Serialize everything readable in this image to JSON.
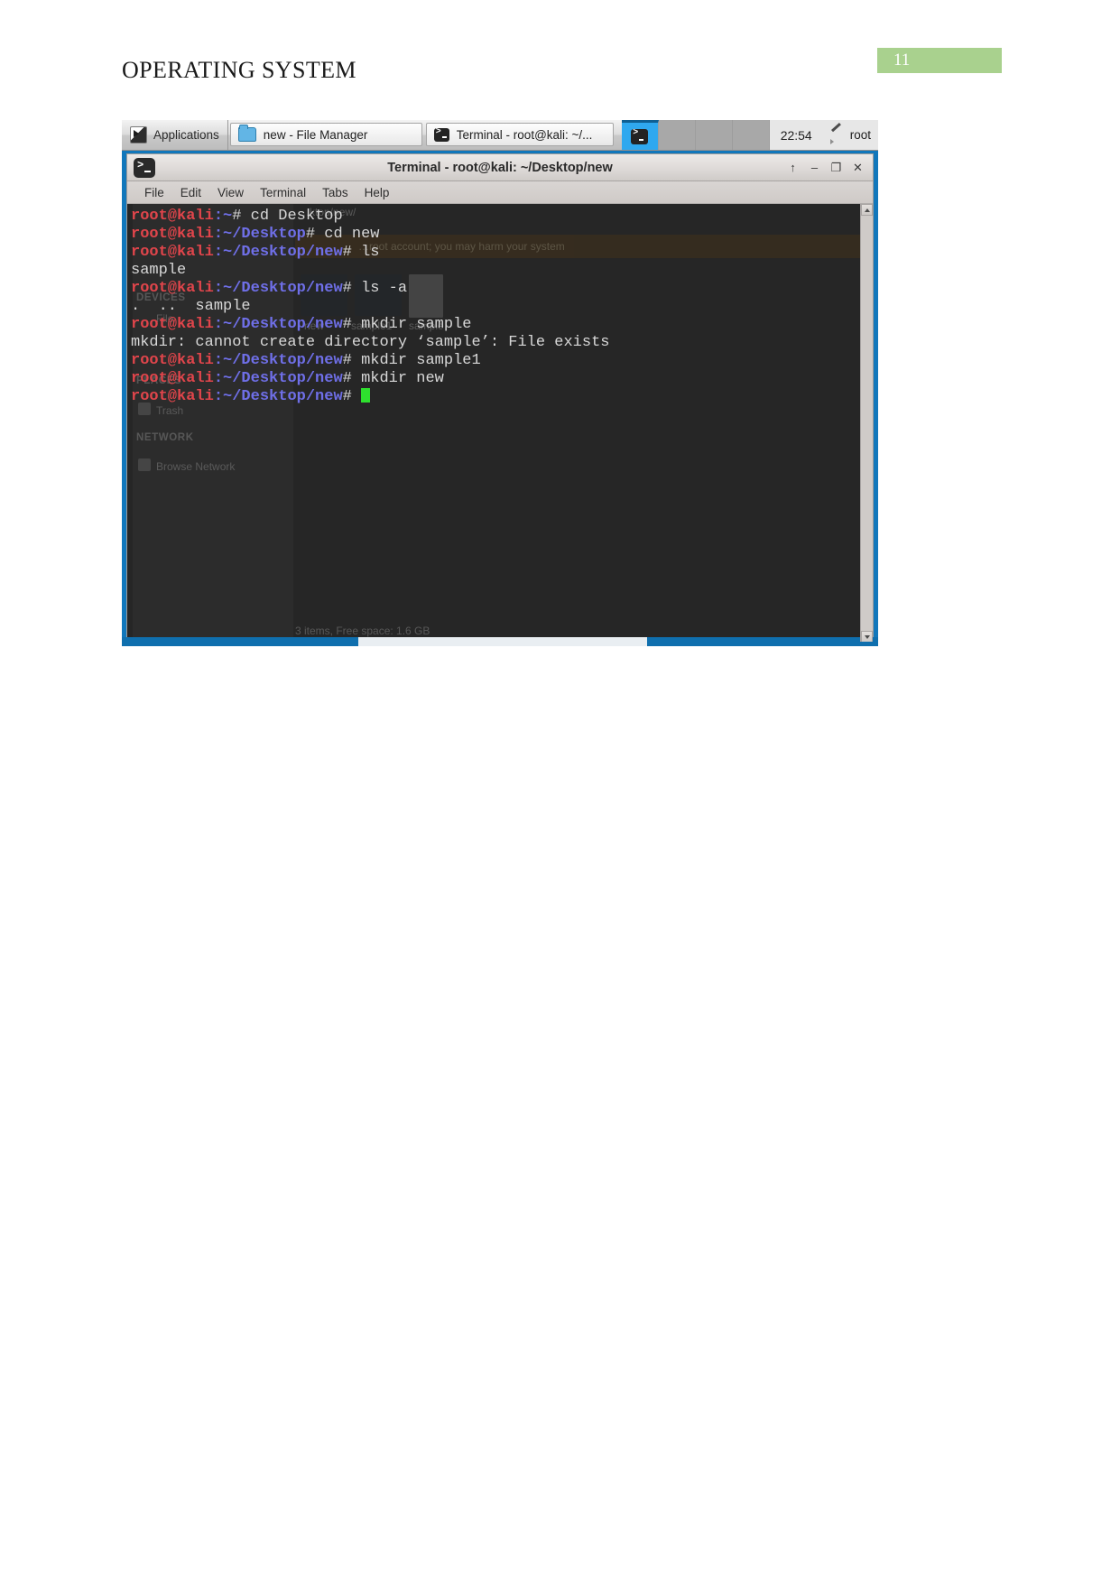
{
  "document": {
    "title": "OPERATING SYSTEM",
    "page_number": "11",
    "badge_color": "#a9d18e"
  },
  "panel": {
    "applications_label": "Applications",
    "applications_icon": "applications-menu-icon",
    "tasks": [
      {
        "label": "new - File Manager",
        "icon": "folder-icon"
      },
      {
        "label": "Terminal - root@kali: ~/...",
        "icon": "terminal-icon"
      }
    ],
    "workspaces": [
      {
        "active": true,
        "icon": "terminal-icon"
      },
      {
        "active": false
      },
      {
        "active": false
      },
      {
        "active": false
      }
    ],
    "clock": "22:54",
    "tray": {
      "pen_icon": "pen-icon",
      "user": "root"
    }
  },
  "terminal_window": {
    "title": "Terminal - root@kali: ~/Desktop/new",
    "icon": "terminal-icon",
    "window_buttons": [
      {
        "name": "shade-button",
        "glyph": "↑"
      },
      {
        "name": "minimize-button",
        "glyph": "–"
      },
      {
        "name": "maximize-button",
        "glyph": "❐"
      },
      {
        "name": "close-button",
        "glyph": "✕"
      }
    ],
    "menus": [
      "File",
      "Edit",
      "View",
      "Terminal",
      "Tabs",
      "Help"
    ],
    "lines": [
      {
        "user": "root@kali",
        "path": ":~",
        "prompt": "# ",
        "cmd": "cd Desktop"
      },
      {
        "user": "root@kali",
        "path": ":~/Desktop",
        "prompt": "# ",
        "cmd": "cd new"
      },
      {
        "user": "root@kali",
        "path": ":~/Desktop/new",
        "prompt": "# ",
        "cmd": "ls"
      },
      {
        "output": "sample"
      },
      {
        "user": "root@kali",
        "path": ":~/Desktop/new",
        "prompt": "# ",
        "cmd": "ls -a"
      },
      {
        "output": ".  ..  sample"
      },
      {
        "user": "root@kali",
        "path": ":~/Desktop/new",
        "prompt": "# ",
        "cmd": "mkdir sample"
      },
      {
        "output": "mkdir: cannot create directory ‘sample’: File exists"
      },
      {
        "user": "root@kali",
        "path": ":~/Desktop/new",
        "prompt": "# ",
        "cmd": "mkdir sample1"
      },
      {
        "user": "root@kali",
        "path": ":~/Desktop/new",
        "prompt": "# ",
        "cmd": "mkdir new"
      },
      {
        "user": "root@kali",
        "path": ":~/Desktop/new",
        "prompt": "# ",
        "cmd": "",
        "cursor": true
      }
    ],
    "colors": {
      "background": "#262626",
      "foreground": "#d8d8d8",
      "user_red": "#e0454b",
      "path_blue": "#6f6fe8",
      "cursor_green": "#2ee02e"
    }
  },
  "file_manager_ghost": {
    "path": "…ktop/new/",
    "warning": "…root account; you may harm your system",
    "sections": [
      {
        "label": "DEVICES"
      },
      {
        "label": "PLACES"
      },
      {
        "label": "NETWORK"
      }
    ],
    "items": [
      {
        "label": "File"
      },
      {
        "label": "Trash"
      },
      {
        "label": "Browse Network"
      }
    ],
    "file_labels": [
      "new",
      "sample1",
      "sample"
    ],
    "status": "3 items, Free space: 1.6 GB"
  }
}
